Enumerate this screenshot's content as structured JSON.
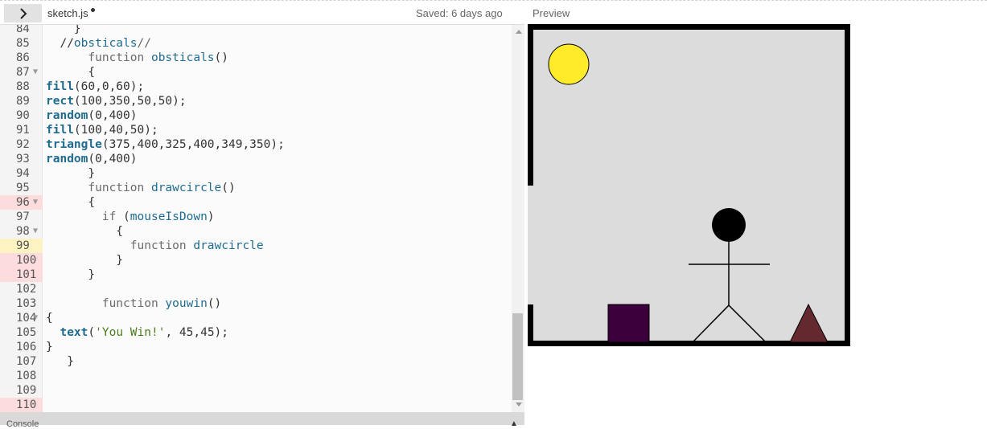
{
  "topbar": {
    "filename": "sketch.js",
    "saved_status": "Saved: 6 days ago",
    "preview_label": "Preview",
    "toggle_icon": "chevron-right-icon"
  },
  "editor": {
    "lines": [
      {
        "n": "84",
        "code": "    }",
        "state": "",
        "fold": false
      },
      {
        "n": "85",
        "code": "  //obsticals//",
        "state": "",
        "fold": false
      },
      {
        "n": "86",
        "code": "      function obsticals()",
        "state": "",
        "fold": false
      },
      {
        "n": "87",
        "code": "      {",
        "state": "",
        "fold": true
      },
      {
        "n": "88",
        "code": "fill(60,0,60);",
        "state": "",
        "fold": false
      },
      {
        "n": "89",
        "code": "rect(100,350,50,50);",
        "state": "",
        "fold": false
      },
      {
        "n": "90",
        "code": "random(0,400)",
        "state": "",
        "fold": false
      },
      {
        "n": "91",
        "code": "fill(100,40,50);",
        "state": "",
        "fold": false
      },
      {
        "n": "92",
        "code": "triangle(375,400,325,400,349,350);",
        "state": "",
        "fold": false
      },
      {
        "n": "93",
        "code": "random(0,400)",
        "state": "",
        "fold": false
      },
      {
        "n": "94",
        "code": "      }",
        "state": "",
        "fold": false
      },
      {
        "n": "95",
        "code": "      function drawcircle()",
        "state": "",
        "fold": false
      },
      {
        "n": "96",
        "code": "      {",
        "state": "err",
        "fold": true
      },
      {
        "n": "97",
        "code": "        if (mouseIsDown)",
        "state": "",
        "fold": false
      },
      {
        "n": "98",
        "code": "          {",
        "state": "",
        "fold": true
      },
      {
        "n": "99",
        "code": "            function drawcircle",
        "state": "warn",
        "fold": false
      },
      {
        "n": "100",
        "code": "          }",
        "state": "err",
        "fold": false
      },
      {
        "n": "101",
        "code": "      }",
        "state": "err",
        "fold": false
      },
      {
        "n": "102",
        "code": "",
        "state": "",
        "fold": false
      },
      {
        "n": "103",
        "code": "        function youwin()",
        "state": "",
        "fold": false
      },
      {
        "n": "104",
        "code": "{",
        "state": "",
        "fold": true
      },
      {
        "n": "105",
        "code": "  text('You Win!', 45,45);",
        "state": "",
        "fold": false
      },
      {
        "n": "106",
        "code": "}",
        "state": "",
        "fold": false
      },
      {
        "n": "107",
        "code": "   }",
        "state": "",
        "fold": false
      },
      {
        "n": "108",
        "code": "",
        "state": "",
        "fold": false
      },
      {
        "n": "109",
        "code": "",
        "state": "",
        "fold": false
      },
      {
        "n": "110",
        "code": "",
        "state": "err",
        "fold": false
      }
    ]
  },
  "console": {
    "label": "Console",
    "caret_icon": "chevron-up-icon"
  },
  "preview": {
    "background": "#dcdcdc",
    "frame_color": "#000000",
    "sun_color": "#ffeb2a",
    "obstacle_rect_color": "#3c003c",
    "obstacle_triangle_color": "#64282f"
  }
}
